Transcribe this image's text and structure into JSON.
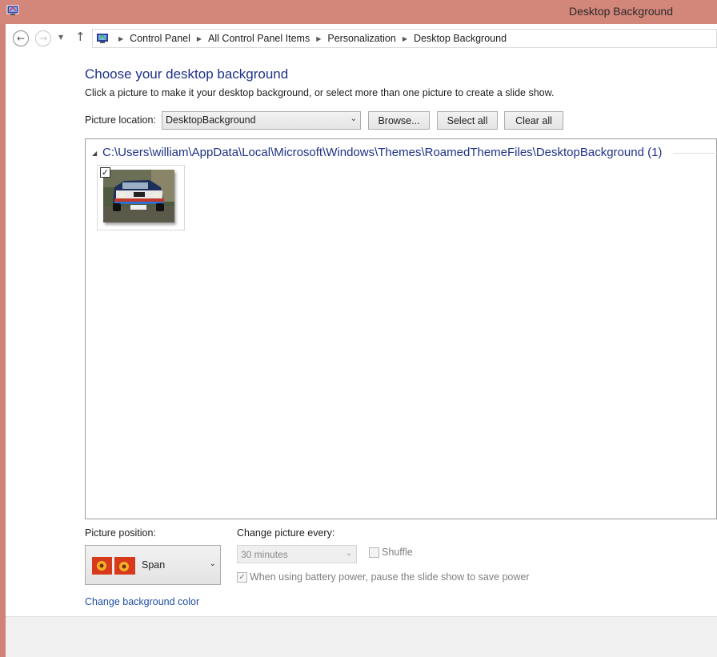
{
  "window": {
    "title": "Desktop Background"
  },
  "nav": {
    "back_icon": "←",
    "forward_icon": "→",
    "recent_icon": "▼",
    "up_icon": "↑",
    "breadcrumbs": [
      "Control Panel",
      "All Control Panel Items",
      "Personalization",
      "Desktop Background"
    ],
    "separator": "▶"
  },
  "content": {
    "title": "Choose your desktop background",
    "instruction": "Click a picture to make it your desktop background, or select more than one picture to create a slide show.",
    "location_label": "Picture location:",
    "location_value": "DesktopBackground",
    "browse_label": "Browse...",
    "select_all_label": "Select all",
    "clear_all_label": "Clear all"
  },
  "gallery": {
    "group_header": "C:\\Users\\william\\AppData\\Local\\Microsoft\\Windows\\Themes\\RoamedThemeFiles\\DesktopBackground (1)",
    "items": [
      {
        "checked": true,
        "check_mark": "✓"
      }
    ]
  },
  "options": {
    "position_label": "Picture position:",
    "position_value": "Span",
    "interval_label": "Change picture every:",
    "interval_value": "30 minutes",
    "shuffle_label": "Shuffle",
    "shuffle_checked": false,
    "battery_label": "When using battery power, pause the slide show to save power",
    "battery_checked": true,
    "battery_check_mark": "✓",
    "bg_color_link": "Change background color"
  },
  "colors": {
    "titlebar": "#d3867a",
    "heading": "#1e3287",
    "link": "#1e4fa1"
  },
  "icons": {
    "app": "control-panel-icon",
    "chevron": "chevron-down-icon"
  }
}
